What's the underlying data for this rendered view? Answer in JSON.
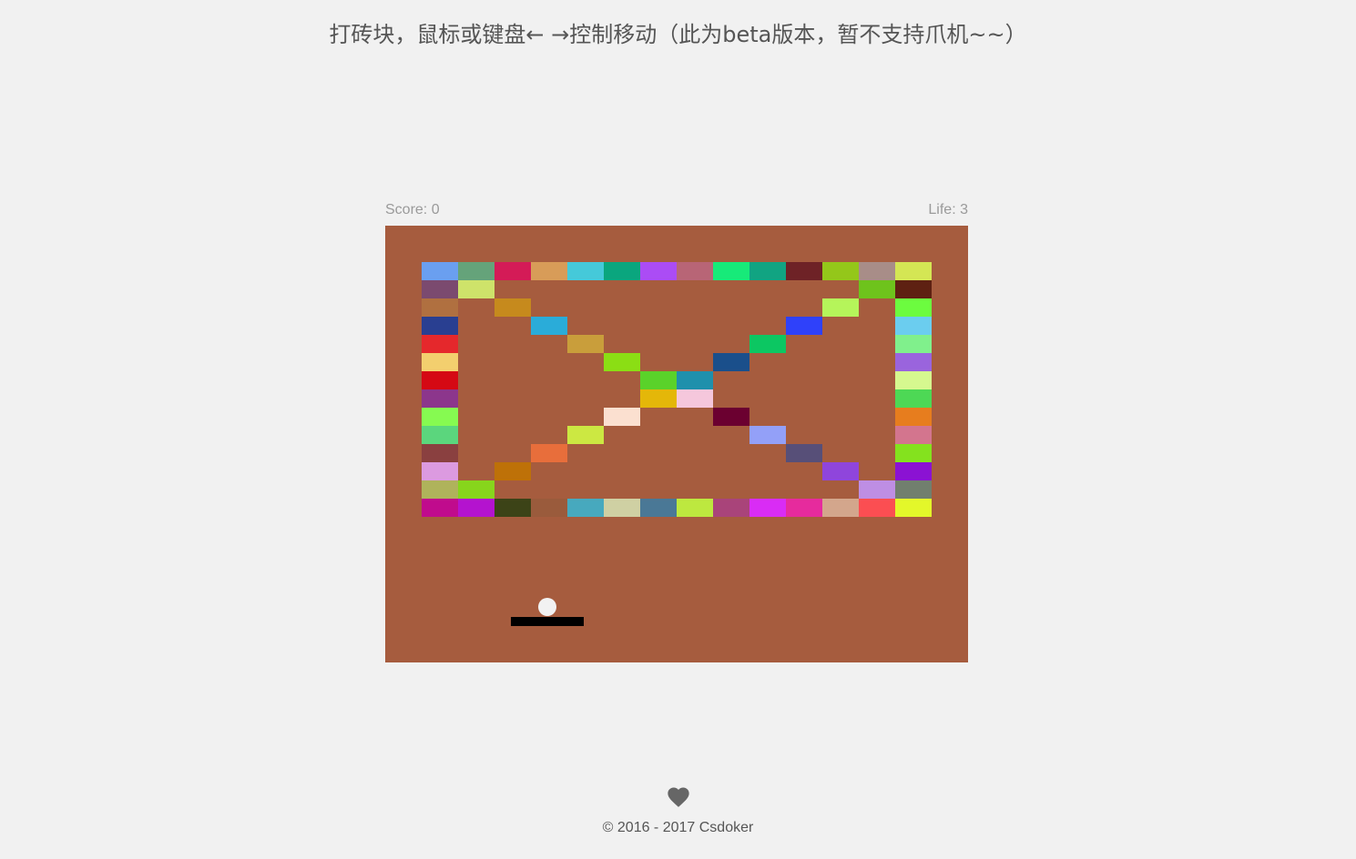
{
  "title": "打砖块，鼠标或键盘← →控制移动（此为beta版本，暂不支持爪机~~）",
  "hud": {
    "score_text": "Score: 0",
    "life_text": "Life: 3"
  },
  "game": {
    "score": 0,
    "life": 3,
    "board_color": "#a65c3e",
    "paddle_color": "#000000",
    "ball_color": "#f2f2f2",
    "bricks": [
      {
        "col": 0,
        "row": 0,
        "color": "#6a9ff0"
      },
      {
        "col": 1,
        "row": 0,
        "color": "#65a37a"
      },
      {
        "col": 2,
        "row": 0,
        "color": "#d41b57"
      },
      {
        "col": 3,
        "row": 0,
        "color": "#d89c58"
      },
      {
        "col": 4,
        "row": 0,
        "color": "#45c9d9"
      },
      {
        "col": 5,
        "row": 0,
        "color": "#0aa67e"
      },
      {
        "col": 6,
        "row": 0,
        "color": "#ab4cf5"
      },
      {
        "col": 7,
        "row": 0,
        "color": "#b86576"
      },
      {
        "col": 8,
        "row": 0,
        "color": "#17ea79"
      },
      {
        "col": 9,
        "row": 0,
        "color": "#11a482"
      },
      {
        "col": 10,
        "row": 0,
        "color": "#6e2226"
      },
      {
        "col": 11,
        "row": 0,
        "color": "#94c71a"
      },
      {
        "col": 12,
        "row": 0,
        "color": "#a88d88"
      },
      {
        "col": 13,
        "row": 0,
        "color": "#d4e654"
      },
      {
        "col": 0,
        "row": 1,
        "color": "#7b4a6f"
      },
      {
        "col": 1,
        "row": 1,
        "color": "#cee36a"
      },
      {
        "col": 12,
        "row": 1,
        "color": "#6ec31c"
      },
      {
        "col": 13,
        "row": 1,
        "color": "#5e2112"
      },
      {
        "col": 0,
        "row": 2,
        "color": "#b07040"
      },
      {
        "col": 2,
        "row": 2,
        "color": "#c68a1d"
      },
      {
        "col": 11,
        "row": 2,
        "color": "#b5f55a"
      },
      {
        "col": 13,
        "row": 2,
        "color": "#6cfc3f"
      },
      {
        "col": 0,
        "row": 3,
        "color": "#293f91"
      },
      {
        "col": 3,
        "row": 3,
        "color": "#2aacd9"
      },
      {
        "col": 10,
        "row": 3,
        "color": "#2f41fa"
      },
      {
        "col": 13,
        "row": 3,
        "color": "#6bcdef"
      },
      {
        "col": 0,
        "row": 4,
        "color": "#e5282c"
      },
      {
        "col": 4,
        "row": 4,
        "color": "#c99e3b"
      },
      {
        "col": 9,
        "row": 4,
        "color": "#0cc762"
      },
      {
        "col": 13,
        "row": 4,
        "color": "#80f08c"
      },
      {
        "col": 0,
        "row": 5,
        "color": "#f3cf6e"
      },
      {
        "col": 5,
        "row": 5,
        "color": "#8bde14"
      },
      {
        "col": 8,
        "row": 5,
        "color": "#1a4f8b"
      },
      {
        "col": 13,
        "row": 5,
        "color": "#9a64dd"
      },
      {
        "col": 0,
        "row": 6,
        "color": "#d50914"
      },
      {
        "col": 6,
        "row": 6,
        "color": "#5ad22a"
      },
      {
        "col": 7,
        "row": 6,
        "color": "#1f90ac"
      },
      {
        "col": 13,
        "row": 6,
        "color": "#d6f88f"
      },
      {
        "col": 0,
        "row": 7,
        "color": "#8c368c"
      },
      {
        "col": 6,
        "row": 7,
        "color": "#e4b709"
      },
      {
        "col": 7,
        "row": 7,
        "color": "#f5c7dc"
      },
      {
        "col": 13,
        "row": 7,
        "color": "#4dd855"
      },
      {
        "col": 0,
        "row": 8,
        "color": "#86fa51"
      },
      {
        "col": 5,
        "row": 8,
        "color": "#fbe0d0"
      },
      {
        "col": 8,
        "row": 8,
        "color": "#6b0030"
      },
      {
        "col": 13,
        "row": 8,
        "color": "#e77d1e"
      },
      {
        "col": 0,
        "row": 9,
        "color": "#5bd67d"
      },
      {
        "col": 4,
        "row": 9,
        "color": "#cce842"
      },
      {
        "col": 9,
        "row": 9,
        "color": "#93a0f8"
      },
      {
        "col": 13,
        "row": 9,
        "color": "#d3758e"
      },
      {
        "col": 0,
        "row": 10,
        "color": "#8a4040"
      },
      {
        "col": 3,
        "row": 10,
        "color": "#e86e3b"
      },
      {
        "col": 10,
        "row": 10,
        "color": "#574f78"
      },
      {
        "col": 13,
        "row": 10,
        "color": "#84e21e"
      },
      {
        "col": 0,
        "row": 11,
        "color": "#dc9ae0"
      },
      {
        "col": 2,
        "row": 11,
        "color": "#be7108"
      },
      {
        "col": 11,
        "row": 11,
        "color": "#8f45dc"
      },
      {
        "col": 13,
        "row": 11,
        "color": "#8b12d3"
      },
      {
        "col": 0,
        "row": 12,
        "color": "#afb35b"
      },
      {
        "col": 1,
        "row": 12,
        "color": "#87d51c"
      },
      {
        "col": 12,
        "row": 12,
        "color": "#be8ee4"
      },
      {
        "col": 13,
        "row": 12,
        "color": "#717f6e"
      },
      {
        "col": 0,
        "row": 13,
        "color": "#c00b8d"
      },
      {
        "col": 1,
        "row": 13,
        "color": "#b413cf"
      },
      {
        "col": 2,
        "row": 13,
        "color": "#3c4317"
      },
      {
        "col": 3,
        "row": 13,
        "color": "#9a5b3c"
      },
      {
        "col": 4,
        "row": 13,
        "color": "#47a9be"
      },
      {
        "col": 5,
        "row": 13,
        "color": "#cfd0a3"
      },
      {
        "col": 6,
        "row": 13,
        "color": "#4a7896"
      },
      {
        "col": 7,
        "row": 13,
        "color": "#bde83f"
      },
      {
        "col": 8,
        "row": 13,
        "color": "#a9447a"
      },
      {
        "col": 9,
        "row": 13,
        "color": "#d92cf5"
      },
      {
        "col": 10,
        "row": 13,
        "color": "#e62b9d"
      },
      {
        "col": 11,
        "row": 13,
        "color": "#d3a68c"
      },
      {
        "col": 12,
        "row": 13,
        "color": "#fb4e52"
      },
      {
        "col": 13,
        "row": 13,
        "color": "#e3f72a"
      }
    ]
  },
  "footer": {
    "icon": "heart-icon",
    "icon_color": "#666666",
    "copyright": "© 2016 - 2017 Csdoker"
  }
}
